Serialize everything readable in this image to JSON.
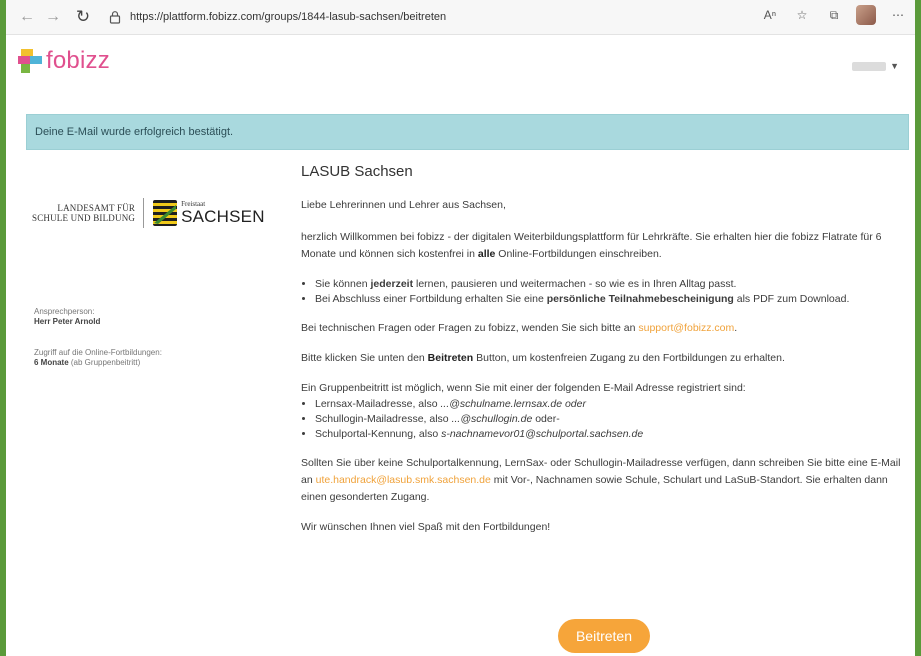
{
  "browser": {
    "url": "https://plattform.fobizz.com/groups/1844-lasub-sachsen/beitreten"
  },
  "site": {
    "logo_text": "fobizz"
  },
  "alert": {
    "text": "Deine E-Mail wurde erfolgreich bestätigt."
  },
  "partner": {
    "lasub_line1": "LANDESAMT FÜR",
    "lasub_line2": "SCHULE UND BILDUNG",
    "freistaat": "Freistaat",
    "sachsen": "SACHSEN"
  },
  "sidebar": {
    "contact_label": "Ansprechperson:",
    "contact_name": "Herr Peter Arnold",
    "access_label": "Zugriff auf die Online-Fortbildungen:",
    "access_value_bold": "6 Monate",
    "access_value_rest": " (ab Gruppenbeitritt)"
  },
  "main": {
    "title": "LASUB Sachsen",
    "greeting": "Liebe Lehrerinnen und Lehrer aus Sachsen,",
    "intro_a": "herzlich Willkommen bei fobizz - der digitalen Weiterbildungsplattform für Lehrkräfte. Sie erhalten hier die fobizz Flatrate für 6 Monate und können sich kostenfrei in ",
    "intro_bold": "alle",
    "intro_b": " Online-Fortbildungen einschreiben.",
    "bullet1_a": "Sie können ",
    "bullet1_bold": "jederzeit",
    "bullet1_b": " lernen, pausieren und weitermachen - so wie es in Ihren Alltag passt.",
    "bullet2_a": "Bei Abschluss einer Fortbildung erhalten Sie eine ",
    "bullet2_bold": "persönliche Teilnahmebescheinigung",
    "bullet2_b": " als PDF zum Download.",
    "tech_a": "Bei technischen Fragen oder Fragen zu fobizz, wenden Sie sich bitte an ",
    "tech_link": "support@fobizz.com",
    "tech_b": ".",
    "click_a": "Bitte klicken Sie unten den ",
    "click_bold": "Beitreten",
    "click_b": " Button, um kostenfreien Zugang zu den Fortbildungen zu erhalten.",
    "group_intro": "Ein Gruppenbeitritt ist möglich, wenn Sie mit einer der folgenden E-Mail Adresse registriert sind:",
    "opt1_a": "Lernsax-Mailadresse, also ",
    "opt1_i": "...@schulname.lernsax.de oder",
    "opt2_a": "Schullogin-Mailadresse, also ",
    "opt2_i": "...@schullogin.de",
    "opt2_b": " oder-",
    "opt3_a": "Schulportal-Kennung, also ",
    "opt3_i": "s-nachnamevor01@schulportal.sachsen.de",
    "none_a": "Sollten Sie über keine Schulportalkennung, LernSax- oder Schullogin-Mailadresse verfügen, dann schreiben Sie bitte eine E-Mail an ",
    "none_link": "ute.handrack@lasub.smk.sachsen.de",
    "none_b": " mit Vor-, Nachnamen sowie Schule, Schulart und LaSuB-Standort. Sie erhalten dann einen gesonderten Zugang.",
    "closing": "Wir wünschen Ihnen viel Spaß mit den Fortbildungen!",
    "join_button": "Beitreten"
  },
  "colors": {
    "accent_orange": "#f6a53a",
    "alert_bg": "#a9d9de",
    "logo_pink": "#e0508e"
  }
}
